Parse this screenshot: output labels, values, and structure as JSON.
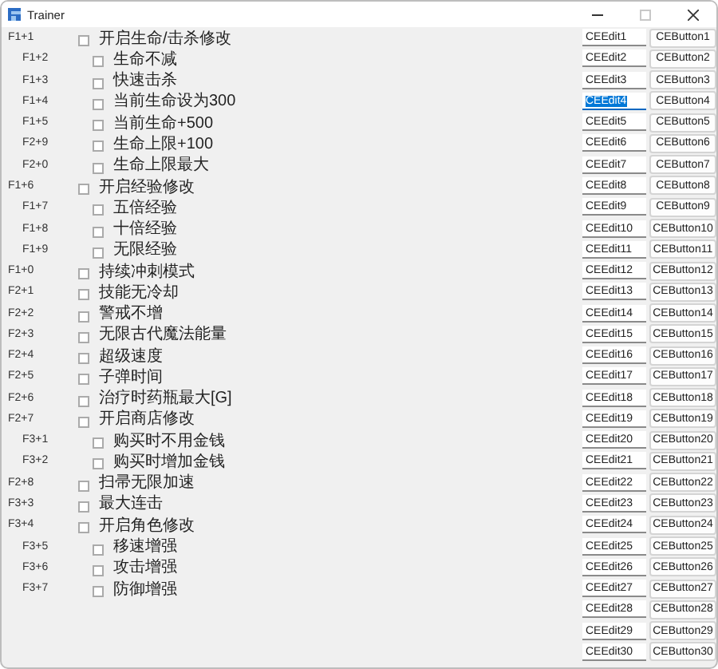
{
  "window": {
    "title": "Trainer",
    "maximize_disabled": true
  },
  "items": [
    {
      "hotkey": "F1+1",
      "label": "开启生命/击杀修改",
      "checked": false,
      "children": [
        {
          "hotkey": "F1+2",
          "label": "生命不减",
          "checked": false
        },
        {
          "hotkey": "F1+3",
          "label": "快速击杀",
          "checked": false
        },
        {
          "hotkey": "F1+4",
          "label": "当前生命设为300",
          "checked": false
        },
        {
          "hotkey": "F1+5",
          "label": "当前生命+500",
          "checked": false
        },
        {
          "hotkey": "F2+9",
          "label": "生命上限+100",
          "checked": false
        },
        {
          "hotkey": "F2+0",
          "label": "生命上限最大",
          "checked": false
        }
      ]
    },
    {
      "hotkey": "F1+6",
      "label": "开启经验修改",
      "checked": false,
      "children": [
        {
          "hotkey": "F1+7",
          "label": "五倍经验",
          "checked": false
        },
        {
          "hotkey": "F1+8",
          "label": "十倍经验",
          "checked": false
        },
        {
          "hotkey": "F1+9",
          "label": "无限经验",
          "checked": false
        }
      ]
    },
    {
      "hotkey": "F1+0",
      "label": "持续冲刺模式",
      "checked": false
    },
    {
      "hotkey": "F2+1",
      "label": "技能无冷却",
      "checked": false
    },
    {
      "hotkey": "F2+2",
      "label": "警戒不增",
      "checked": false
    },
    {
      "hotkey": "F2+3",
      "label": "无限古代魔法能量",
      "checked": false
    },
    {
      "hotkey": "F2+4",
      "label": "超级速度",
      "checked": false
    },
    {
      "hotkey": "F2+5",
      "label": "子弹时间",
      "checked": false
    },
    {
      "hotkey": "F2+6",
      "label": "治疗时药瓶最大[G]",
      "checked": false
    },
    {
      "hotkey": "F2+7",
      "label": "开启商店修改",
      "checked": false,
      "children": [
        {
          "hotkey": "F3+1",
          "label": "购买时不用金钱",
          "checked": false
        },
        {
          "hotkey": "F3+2",
          "label": "购买时增加金钱",
          "checked": false
        }
      ]
    },
    {
      "hotkey": "F2+8",
      "label": "扫帚无限加速",
      "checked": false
    },
    {
      "hotkey": "F3+3",
      "label": "最大连击",
      "checked": false
    },
    {
      "hotkey": "F3+4",
      "label": "开启角色修改",
      "checked": false,
      "children": [
        {
          "hotkey": "F3+5",
          "label": "移速增强",
          "checked": false
        },
        {
          "hotkey": "F3+6",
          "label": "攻击增强",
          "checked": false
        },
        {
          "hotkey": "F3+7",
          "label": "防御增强",
          "checked": false
        }
      ]
    }
  ],
  "controls": [
    {
      "field": {
        "value": "CEEdit1",
        "selected": false
      },
      "button": "CEButton1"
    },
    {
      "field": {
        "value": "CEEdit2",
        "selected": false
      },
      "button": "CEButton2"
    },
    {
      "field": {
        "value": "CEEdit3",
        "selected": false
      },
      "button": "CEButton3"
    },
    {
      "field": {
        "value": "CEEdit4",
        "selected": true
      },
      "button": "CEButton4"
    },
    {
      "field": {
        "value": "CEEdit5",
        "selected": false
      },
      "button": "CEButton5"
    },
    {
      "field": {
        "value": "CEEdit6",
        "selected": false
      },
      "button": "CEButton6"
    },
    {
      "field": {
        "value": "CEEdit7",
        "selected": false
      },
      "button": "CEButton7"
    },
    {
      "field": {
        "value": "CEEdit8",
        "selected": false
      },
      "button": "CEButton8"
    },
    {
      "field": {
        "value": "CEEdit9",
        "selected": false
      },
      "button": "CEButton9"
    },
    {
      "field": {
        "value": "CEEdit10",
        "selected": false
      },
      "button": "CEButton10"
    },
    {
      "field": {
        "value": "CEEdit11",
        "selected": false
      },
      "button": "CEButton11"
    },
    {
      "field": {
        "value": "CEEdit12",
        "selected": false
      },
      "button": "CEButton12"
    },
    {
      "field": {
        "value": "CEEdit13",
        "selected": false
      },
      "button": "CEButton13"
    },
    {
      "field": {
        "value": "CEEdit14",
        "selected": false
      },
      "button": "CEButton14"
    },
    {
      "field": {
        "value": "CEEdit15",
        "selected": false
      },
      "button": "CEButton15"
    },
    {
      "field": {
        "value": "CEEdit16",
        "selected": false
      },
      "button": "CEButton16"
    },
    {
      "field": {
        "value": "CEEdit17",
        "selected": false
      },
      "button": "CEButton17"
    },
    {
      "field": {
        "value": "CEEdit18",
        "selected": false
      },
      "button": "CEButton18"
    },
    {
      "field": {
        "value": "CEEdit19",
        "selected": false
      },
      "button": "CEButton19"
    },
    {
      "field": {
        "value": "CEEdit20",
        "selected": false
      },
      "button": "CEButton20"
    },
    {
      "field": {
        "value": "CEEdit21",
        "selected": false
      },
      "button": "CEButton21"
    },
    {
      "field": {
        "value": "CEEdit22",
        "selected": false
      },
      "button": "CEButton22"
    },
    {
      "field": {
        "value": "CEEdit23",
        "selected": false
      },
      "button": "CEButton23"
    },
    {
      "field": {
        "value": "CEEdit24",
        "selected": false
      },
      "button": "CEButton24"
    },
    {
      "field": {
        "value": "CEEdit25",
        "selected": false
      },
      "button": "CEButton25"
    },
    {
      "field": {
        "value": "CEEdit26",
        "selected": false
      },
      "button": "CEButton26"
    },
    {
      "field": {
        "value": "CEEdit27",
        "selected": false
      },
      "button": "CEButton27"
    },
    {
      "field": {
        "value": "CEEdit28",
        "selected": false
      },
      "button": "CEButton28"
    },
    {
      "field": {
        "value": "CEEdit29",
        "selected": false
      },
      "button": "CEButton29"
    },
    {
      "field": {
        "value": "CEEdit30",
        "selected": false
      },
      "button": "CEButton30"
    }
  ]
}
